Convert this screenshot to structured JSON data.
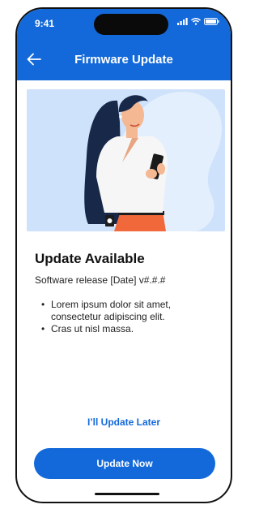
{
  "status_bar": {
    "time": "9:41",
    "icons": [
      "signal-icon",
      "wifi-icon",
      "battery-icon"
    ]
  },
  "header": {
    "title": "Firmware Update",
    "back_icon": "arrow-left-icon"
  },
  "content": {
    "heading": "Update Available",
    "release": "Software release [Date] v#.#.#",
    "bullets": [
      "Lorem ipsum dolor sit amet, consectetur adipiscing elit.",
      "Cras ut nisl massa."
    ]
  },
  "actions": {
    "later_label": "I’ll Update Later",
    "update_label": "Update Now"
  },
  "colors": {
    "primary": "#1369d9",
    "illustration_bg": "#cfe2fb"
  }
}
